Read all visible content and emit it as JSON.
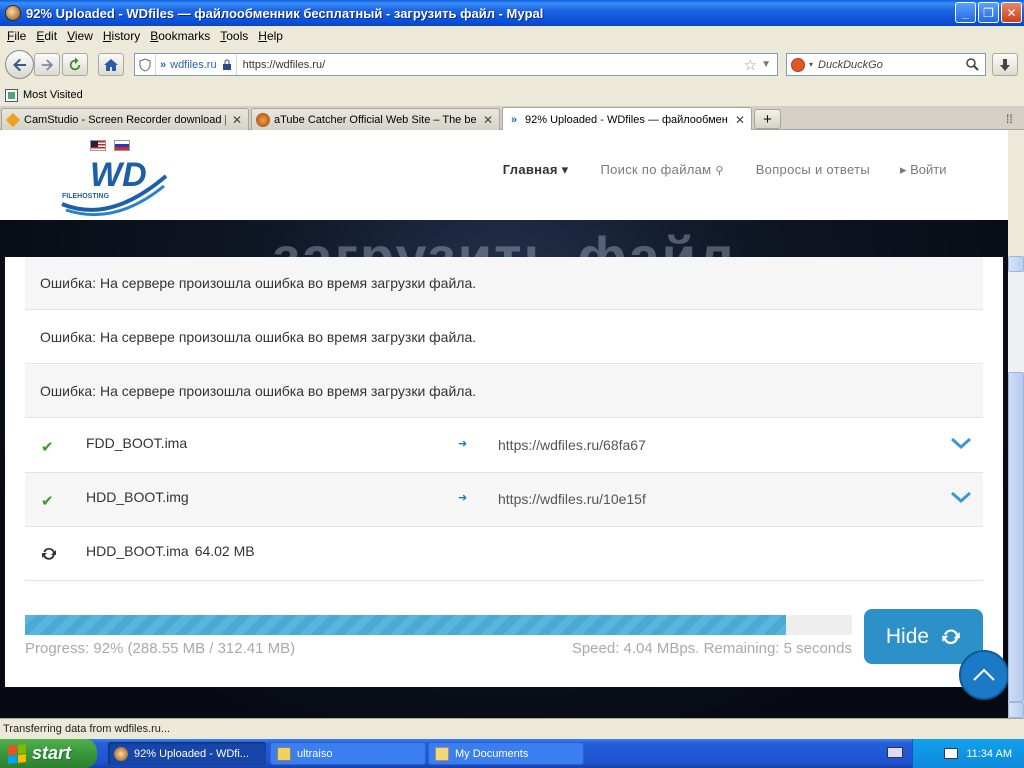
{
  "window": {
    "title": "92% Uploaded - WDfiles — файлообменник бесплатный - загрузить файл - Mypal",
    "controls": [
      "_",
      "❐",
      "✕"
    ]
  },
  "menubar": [
    "File",
    "Edit",
    "View",
    "History",
    "Bookmarks",
    "Tools",
    "Help"
  ],
  "navbar": {
    "identity_domain": "wdfiles.ru",
    "url": "https://wdfiles.ru/",
    "search_placeholder": "DuckDuckGo"
  },
  "bookmarks": {
    "most_visited": "Most Visited"
  },
  "tabs": [
    {
      "label": "CamStudio - Screen Recorder download |...",
      "icon": "camstudio-icon"
    },
    {
      "label": "aTube Catcher Official Web Site – The be...",
      "icon": "atube-icon"
    },
    {
      "label": "92% Uploaded - WDfiles — файлообмен...",
      "icon": "wdfiles-icon",
      "active": true
    }
  ],
  "site": {
    "logo_text": "WD",
    "logo_subtext": "FILEHOSTING",
    "nav": [
      "Главная ▾",
      "Поиск по файлам",
      "Вопросы и ответы",
      "▸ Войти"
    ],
    "banner_title": "загрузить файл"
  },
  "errors": [
    "Ошибка: На сервере произошла ошибка во время загрузки файла.",
    "Ошибка: На сервере произошла ошибка во время загрузки файла.",
    "Ошибка: На сервере произошла ошибка во время загрузки файла."
  ],
  "files": [
    {
      "name": "FDD_BOOT.ima",
      "status": "done",
      "link": "https://wdfiles.ru/68fa67"
    },
    {
      "name": "HDD_BOOT.img",
      "status": "done",
      "link": "https://wdfiles.ru/10e15f"
    },
    {
      "name": "HDD_BOOT.ima",
      "status": "uploading",
      "size": "64.02 MB"
    }
  ],
  "progress": {
    "percent": 0.92,
    "text": "Progress: 92% (288.55 MB / 312.41 MB)",
    "speed_text": "Speed: 4.04 MBps. Remaining: 5 seconds",
    "hide_label": "Hide"
  },
  "statusbar": "Transferring data from wdfiles.ru...",
  "taskbar": {
    "start": "start",
    "tasks": [
      "92% Uploaded - WDfi...",
      "ultraiso",
      "My Documents"
    ],
    "clock": "11:34 AM"
  },
  "colors": {
    "accent": "#2b91c8",
    "progress": "#58b6dd",
    "check": "#3a9a2a",
    "xp_blue": "#245edb"
  }
}
